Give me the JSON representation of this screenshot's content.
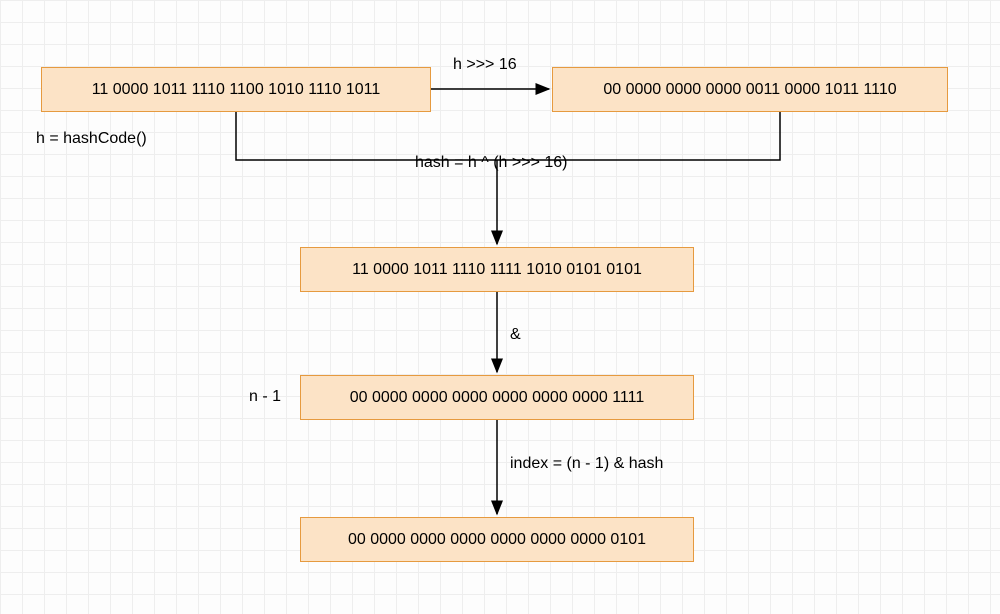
{
  "boxes": {
    "hashCode": "11 0000 1011 1110 1100 1010 1110 1011",
    "shifted": "00 0000 0000 0000 0011 0000 1011 1110",
    "hash": "11 0000 1011 1110 1111 1010 0101 0101",
    "nMinus1": "00 0000 0000 0000 0000 0000 0000 1111",
    "index": "00 0000 0000 0000 0000 0000 0000 0101"
  },
  "labels": {
    "hEqualsHashCode": "h = hashCode()",
    "hShift16": "h >>> 16",
    "hashXor": "hash = h ^ (h >>> 16)",
    "ampersand": "&",
    "nMinus1Label": "n - 1",
    "indexFormula": "index = (n - 1) & hash"
  }
}
